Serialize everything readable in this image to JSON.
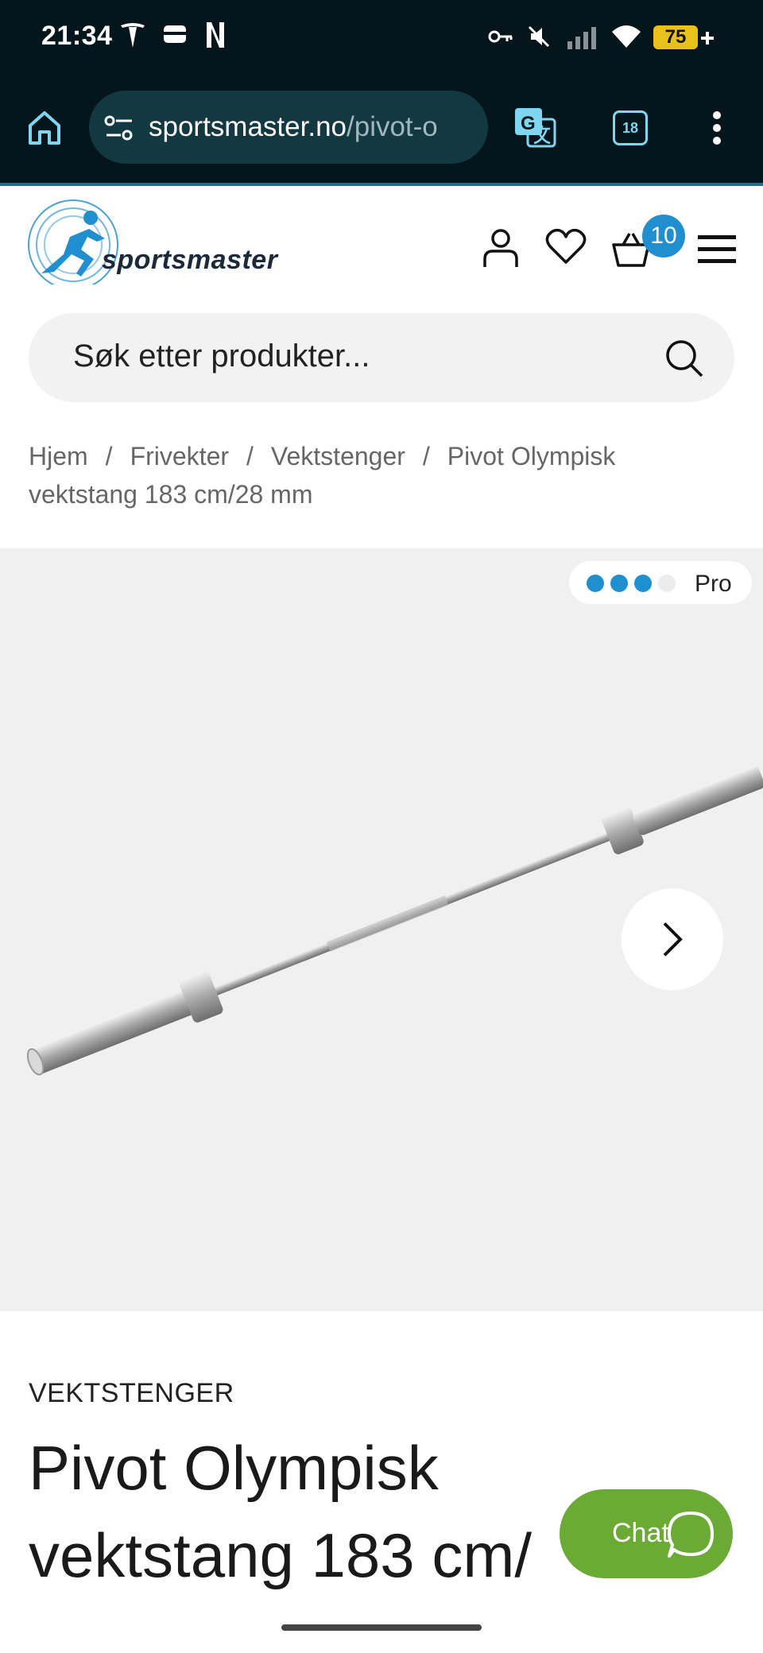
{
  "status_bar": {
    "time": "21:34",
    "battery": "75",
    "left_icons": [
      "tesla-icon",
      "wallet-icon",
      "netflix-icon"
    ],
    "right_icons": [
      "vpn-key-icon",
      "mute-icon",
      "signal-icon",
      "wifi-icon",
      "battery-icon"
    ]
  },
  "browser": {
    "url_domain": "sportsmaster.no",
    "url_path": "/pivot-o",
    "tab_count": "18"
  },
  "site": {
    "logo_text": "sportsmaster",
    "cart_count": "10",
    "search_placeholder": "Søk etter produkter..."
  },
  "breadcrumb": {
    "items": [
      "Hjem",
      "Frivekter",
      "Vektstenger",
      "Pivot Olympisk vektstang 183 cm/28 mm"
    ],
    "separator": "/"
  },
  "gallery": {
    "badge_label": "Pro",
    "dots_filled": 3,
    "dots_total": 4
  },
  "product": {
    "category": "VEKTSTENGER",
    "title_line1": "Pivot Olympisk",
    "title_line2": "vektstang 183 cm/"
  },
  "chat": {
    "label": "Chat"
  },
  "colors": {
    "accent_blue": "#1f8fd0",
    "chat_green": "#6aaa35",
    "dark_bar": "#04151c"
  }
}
